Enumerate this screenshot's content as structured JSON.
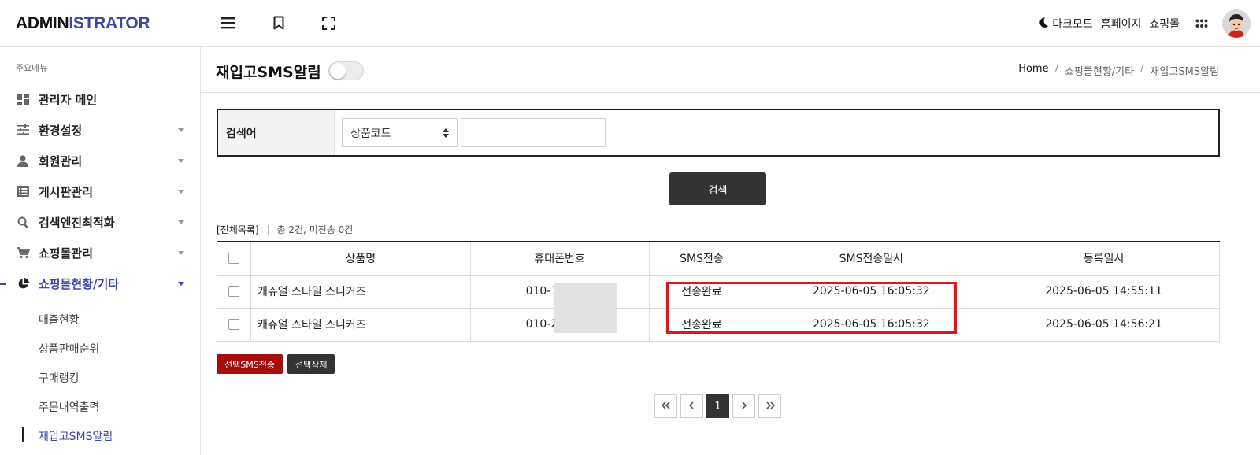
{
  "header": {
    "logo_part1": "ADMIN",
    "logo_part2": "ISTRATOR",
    "dark_mode_label": "다크모드",
    "homepage_label": "홈페이지",
    "shop_label": "쇼핑몰"
  },
  "sidebar": {
    "section_label": "주요메뉴",
    "items": [
      {
        "label": "관리자 메인",
        "icon": "dashboard-icon"
      },
      {
        "label": "환경설정",
        "icon": "sliders-icon"
      },
      {
        "label": "회원관리",
        "icon": "person-icon"
      },
      {
        "label": "게시판관리",
        "icon": "list-icon"
      },
      {
        "label": "검색엔진최적화",
        "icon": "search-icon"
      },
      {
        "label": "쇼핑몰관리",
        "icon": "cart-icon"
      },
      {
        "label": "쇼핑몰현황/기타",
        "icon": "pie-chart-icon"
      }
    ],
    "subitems": [
      "매출현황",
      "상품판매순위",
      "구매랭킹",
      "주문내역출력",
      "재입고SMS알림"
    ]
  },
  "page": {
    "title": "재입고SMS알림",
    "breadcrumb": [
      "Home",
      "쇼핑몰현황/기타",
      "재입고SMS알림"
    ]
  },
  "search": {
    "label": "검색어",
    "select_value": "상품코드",
    "input_value": "",
    "button_label": "검색"
  },
  "list": {
    "all_label": "[전체목록]",
    "summary": "총 2건, 미전송 0건"
  },
  "table": {
    "headers": [
      "상품명",
      "휴대폰번호",
      "SMS전송",
      "SMS전송일시",
      "등록일시"
    ],
    "rows": [
      {
        "product": "캐쥬얼 스타일 스니커즈",
        "phone": "010-12",
        "sms": "전송완료",
        "sent_at": "2025-06-05 16:05:32",
        "registered_at": "2025-06-05 14:55:11"
      },
      {
        "product": "캐쥬얼 스타일 스니커즈",
        "phone": "010-23",
        "sms": "전송완료",
        "sent_at": "2025-06-05 16:05:32",
        "registered_at": "2025-06-05 14:56:21"
      }
    ]
  },
  "actions": {
    "send_sms_label": "선택SMS전송",
    "delete_label": "선택삭제"
  },
  "pagination": {
    "current_page": "1",
    "first_icon": "double-chevron-left-icon",
    "prev_icon": "chevron-left-icon",
    "next_icon": "chevron-right-icon",
    "last_icon": "double-chevron-right-icon"
  },
  "colors": {
    "brand": "#3b46a8",
    "sms_button": "#a60c0c",
    "highlight_box": "#e2141e"
  }
}
